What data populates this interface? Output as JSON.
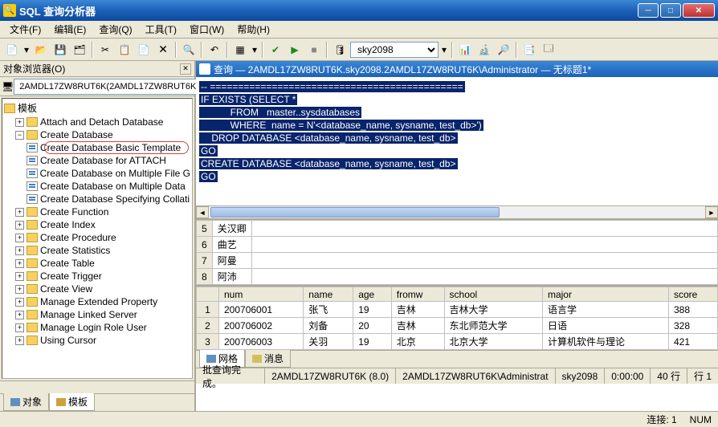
{
  "window": {
    "title": "SQL 查询分析器"
  },
  "menu": {
    "file": "文件(F)",
    "edit": "编辑(E)",
    "query": "查询(Q)",
    "tools": "工具(T)",
    "window": "窗口(W)",
    "help": "帮助(H)"
  },
  "toolbar": {
    "db_value": "sky2098"
  },
  "left_panel": {
    "title": "对象浏览器(O)",
    "server_combo": "2AMDL17ZW8RUT6K(2AMDL17ZW8RUT6K",
    "root": "模板",
    "tree": [
      {
        "label": "Attach and Detach Database",
        "expand": "+"
      },
      {
        "label": "Create Database",
        "expand": "−",
        "children": [
          {
            "label": "Create Database Basic Template",
            "highlight": true
          },
          {
            "label": "Create Database for ATTACH"
          },
          {
            "label": "Create Database on Multiple File G"
          },
          {
            "label": "Create Database on Multiple Data"
          },
          {
            "label": "Create Database Specifying Collati"
          }
        ]
      },
      {
        "label": "Create Function",
        "expand": "+"
      },
      {
        "label": "Create Index",
        "expand": "+"
      },
      {
        "label": "Create Procedure",
        "expand": "+"
      },
      {
        "label": "Create Statistics",
        "expand": "+"
      },
      {
        "label": "Create Table",
        "expand": "+"
      },
      {
        "label": "Create Trigger",
        "expand": "+"
      },
      {
        "label": "Create View",
        "expand": "+"
      },
      {
        "label": "Manage Extended Property",
        "expand": "+"
      },
      {
        "label": "Manage Linked Server",
        "expand": "+"
      },
      {
        "label": "Manage Login Role User",
        "expand": "+"
      },
      {
        "label": "Using Cursor",
        "expand": "+"
      }
    ],
    "tabs": {
      "objects": "对象",
      "templates": "模板"
    }
  },
  "query_panel": {
    "title": "查询 — 2AMDL17ZW8RUT6K.sky2098.2AMDL17ZW8RUT6K\\Administrator — 无标题1*",
    "sql": {
      "l1": "-- =============================================",
      "l2": "IF EXISTS (SELECT *",
      "l3": "           FROM   master..sysdatabases",
      "l4": "           WHERE  name = N'<database_name, sysname, test_db>')",
      "l5": "    DROP DATABASE <database_name, sysname, test_db>",
      "l6": "GO",
      "l7": "",
      "l8": "CREATE DATABASE <database_name, sysname, test_db>",
      "l9": "GO"
    }
  },
  "grid_top": {
    "rows": [
      {
        "n": "5",
        "c1": "关汉卿"
      },
      {
        "n": "6",
        "c1": "曲艺"
      },
      {
        "n": "7",
        "c1": "阿曼"
      },
      {
        "n": "8",
        "c1": "阿沛"
      }
    ]
  },
  "grid_bottom": {
    "headers": [
      "num",
      "name",
      "age",
      "fromw",
      "school",
      "major",
      "score"
    ],
    "rows": [
      {
        "n": "1",
        "num": "200706001",
        "name": "张飞",
        "age": "19",
        "fromw": "吉林",
        "school": "吉林大学",
        "major": "语言学",
        "score": "388"
      },
      {
        "n": "2",
        "num": "200706002",
        "name": "刘备",
        "age": "20",
        "fromw": "吉林",
        "school": "东北师范大学",
        "major": "日语",
        "score": "328"
      },
      {
        "n": "3",
        "num": "200706003",
        "name": "关羽",
        "age": "19",
        "fromw": "北京",
        "school": "北京大学",
        "major": "计算机软件与理论",
        "score": "421"
      }
    ]
  },
  "result_tabs": {
    "grid": "网格",
    "messages": "消息"
  },
  "status": {
    "msg": "批查询完成。",
    "server": "2AMDL17ZW8RUT6K (8.0)",
    "user": "2AMDL17ZW8RUT6K\\Administrat",
    "db": "sky2098",
    "time": "0:00:00",
    "rows": "40 行",
    "line": "行 1"
  },
  "bottom": {
    "conn": "连接: 1",
    "nums": "NUM"
  }
}
